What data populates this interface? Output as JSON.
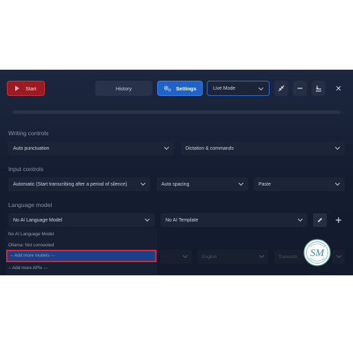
{
  "toolbar": {
    "start_label": "Start",
    "history_label": "History",
    "settings_label": "Settings",
    "mode_value": "Live Mode"
  },
  "writing_controls": {
    "label": "Writing controls",
    "punctuation_value": "Auto punctuation",
    "dictation_value": "Dictation & commands"
  },
  "input_controls": {
    "label": "Input controls",
    "trigger_value": "Automatic (Start transcribing after a period of silence)",
    "spacing_value": "Auto spacing",
    "output_value": "Paste"
  },
  "language_model": {
    "label": "Language model",
    "model_value": "No AI Language Model",
    "template_value": "No AI Template"
  },
  "model_dropdown": {
    "items": [
      "No AI Language Model",
      "Ollama: Not connected",
      "-- Add more models ---",
      "-- Add more APIs ---"
    ],
    "highlighted_index": 2
  },
  "speech_row": {
    "language_value": "English",
    "service_value": "Transcrib"
  },
  "logo": {
    "text": "SM"
  },
  "colors": {
    "accent": "#1f63c8",
    "start": "#9c1a22",
    "highlight_border": "#d9263a"
  }
}
